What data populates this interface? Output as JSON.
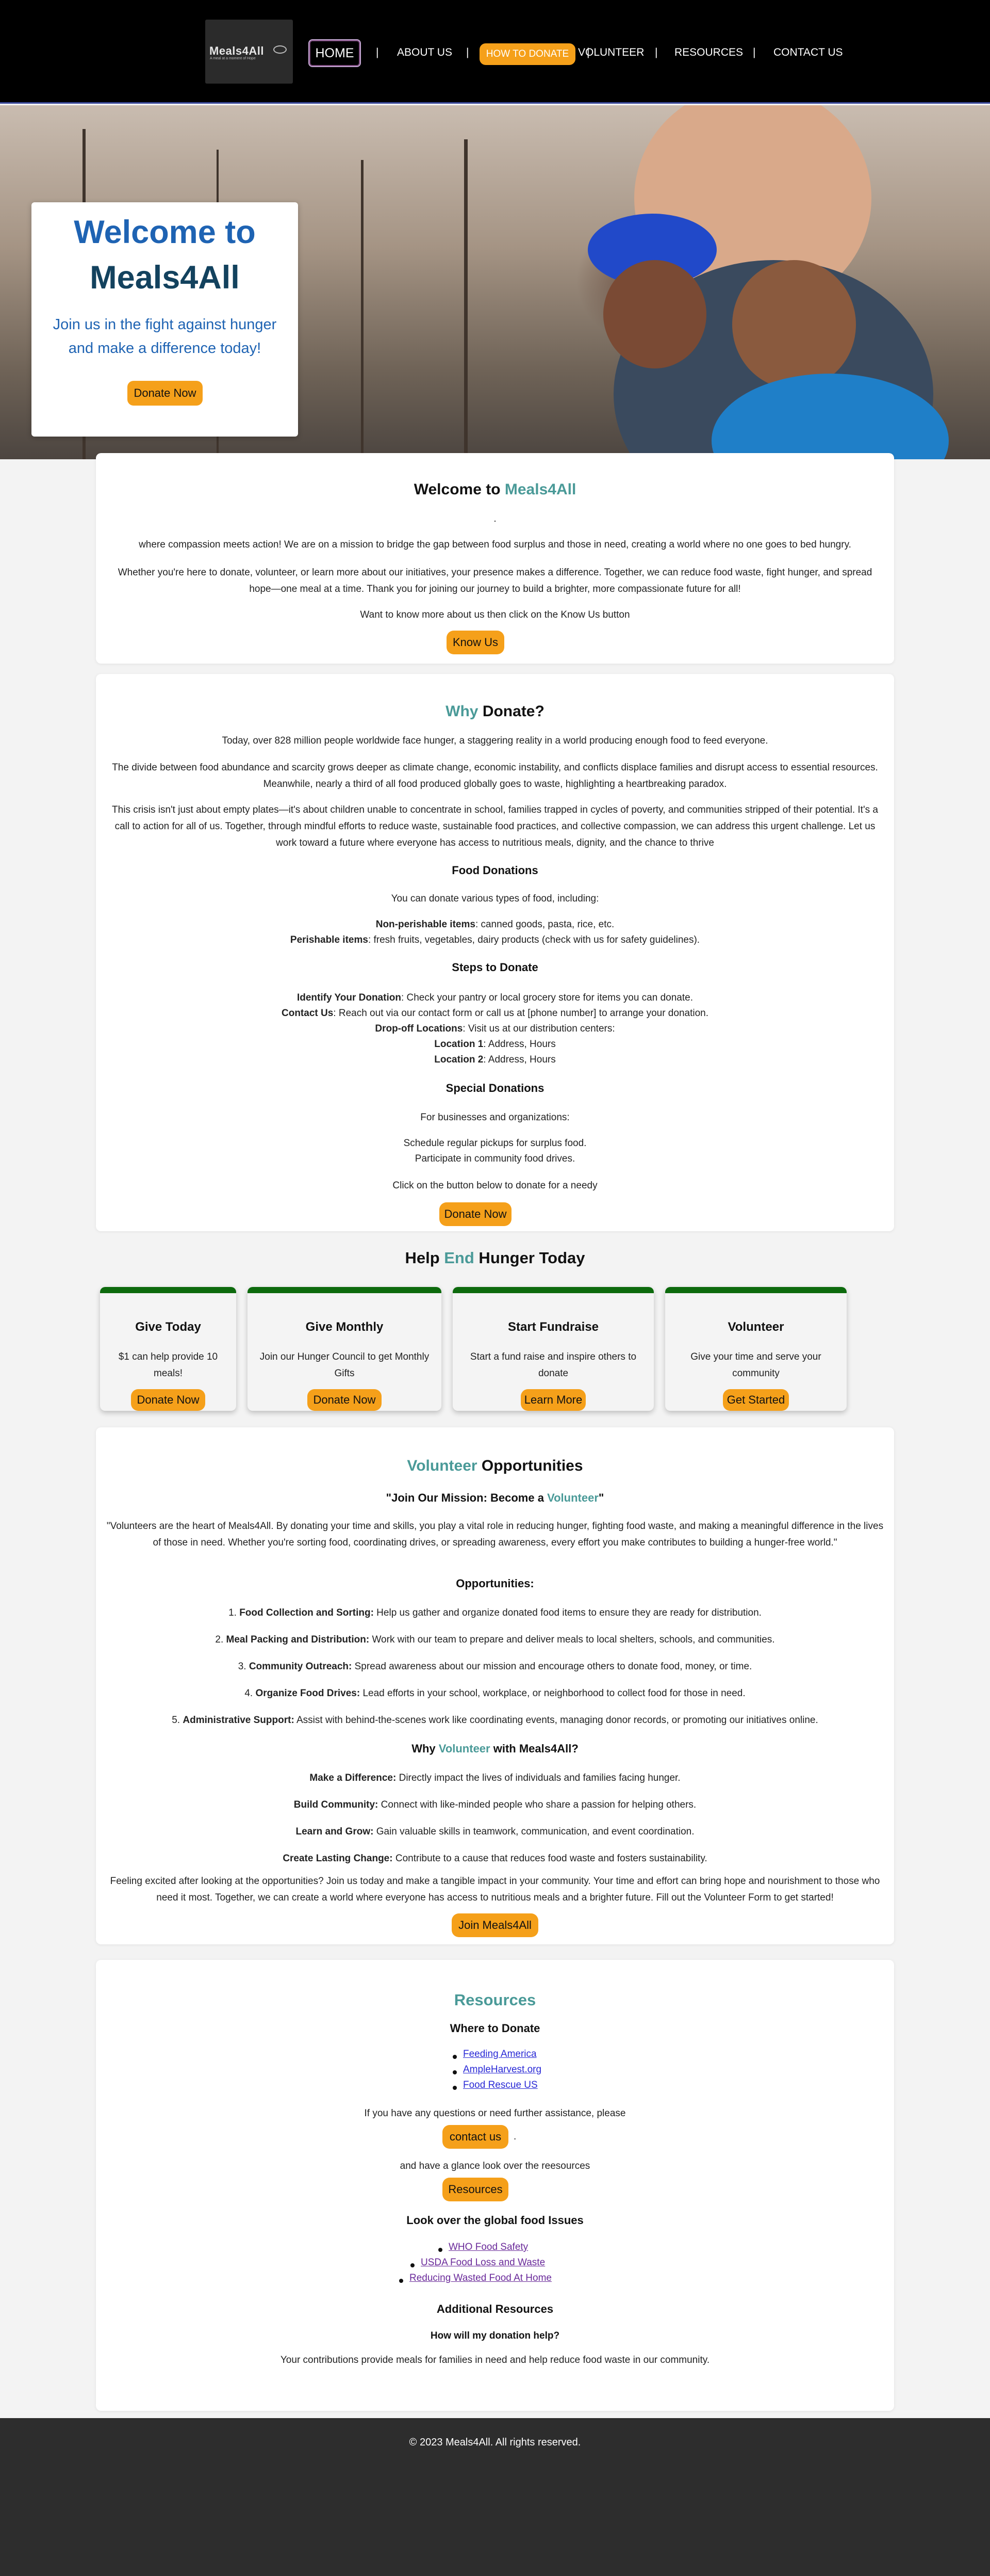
{
  "nav": {
    "logo_text": "Meals4All",
    "logo_tagline": "A meal at a moment of Hope",
    "home": "HOME",
    "about": "ABOUT US",
    "donate": "HOW TO DONATE",
    "volunteer": "VOLUNTEER",
    "resources": "RESOURCES",
    "contact": "CONTACT US",
    "separator": "|"
  },
  "hero": {
    "title_line1": "Welcome to",
    "title_line2": "Meals4All",
    "subtitle": "Join us in the fight against hunger and make a difference today!",
    "button": "Donate Now"
  },
  "welcome": {
    "title_prefix": "Welcome to ",
    "title_brand": "Meals4All",
    "dot": ".",
    "p1": "where compassion meets action! We are on a mission to bridge the gap between food surplus and those in need, creating a world where no one goes to bed hungry.",
    "p2": "Whether you're here to donate, volunteer, or learn more about our initiatives, your presence makes a difference. Together, we can reduce food waste, fight hunger, and spread hope—one meal at a time. Thank you for joining our journey to build a brighter, more compassionate future for all!",
    "p3": "Want to know more about us then click on the Know Us button",
    "button": "Know Us"
  },
  "why_donate": {
    "title_accent": "Why",
    "title_rest": " Donate?",
    "p1": "Today, over 828 million people worldwide face hunger, a staggering reality in a world producing enough food to feed everyone.",
    "p2": "The divide between food abundance and scarcity grows deeper as climate change, economic instability, and conflicts displace families and disrupt access to essential resources. Meanwhile, nearly a third of all food produced globally goes to waste, highlighting a heartbreaking paradox.",
    "p3": "This crisis isn't just about empty plates—it's about children unable to concentrate in school, families trapped in cycles of poverty, and communities stripped of their potential. It's a call to action for all of us. Together, through mindful efforts to reduce waste, sustainable food practices, and collective compassion, we can address this urgent challenge. Let us work toward a future where everyone has access to nutritious meals, dignity, and the chance to thrive",
    "food_heading": "Food Donations",
    "food_intro": "You can donate various types of food, including:",
    "nonperish_label": "Non-perishable items",
    "nonperish_text": ": canned goods, pasta, rice, etc.",
    "perish_label": "Perishable items",
    "perish_text": ": fresh fruits, vegetables, dairy products (check with us for safety guidelines).",
    "steps_heading": "Steps to Donate",
    "step1_label": "Identify Your Donation",
    "step1_text": ": Check your pantry or local grocery store for items you can donate.",
    "step2_label": "Contact Us",
    "step2_text": ": Reach out via our contact form or call us at [phone number] to arrange your donation.",
    "step3_label": "Drop-off Locations",
    "step3_text": ": Visit us at our distribution centers:",
    "loc1_label": "Location 1",
    "loc1_text": ": Address, Hours",
    "loc2_label": "Location 2",
    "loc2_text": ": Address, Hours",
    "special_heading": "Special Donations",
    "special_intro": "For businesses and organizations:",
    "special1": "Schedule regular pickups for surplus food.",
    "special2": "Participate in community food drives.",
    "cta": "Click on the button below to donate for a needy",
    "button": "Donate Now"
  },
  "help": {
    "title_prefix": "Help ",
    "title_accent": "End",
    "title_suffix": " Hunger Today",
    "cards": [
      {
        "title": "Give Today",
        "text": "$1 can help provide 10 meals!",
        "button": "Donate Now"
      },
      {
        "title": "Give Monthly",
        "text": "Join our Hunger Council to get Monthly Gifts",
        "button": "Donate Now"
      },
      {
        "title": "Start Fundraise",
        "text": "Start a fund raise and inspire others to donate",
        "button": "Learn More"
      },
      {
        "title": "Volunteer",
        "text": "Give your time and serve your community",
        "button": "Get Started"
      }
    ]
  },
  "volunteer": {
    "title_accent": "Volunteer",
    "title_rest": " Opportunities",
    "mission_prefix": "\"Join Our Mission: Become a ",
    "mission_accent": "Volunteer",
    "mission_suffix": "\"",
    "quote": "\"Volunteers are the heart of Meals4All. By donating your time and skills, you play a vital role in reducing hunger, fighting food waste, and making a meaningful difference in the lives of those in need. Whether you're sorting food, coordinating drives, or spreading awareness, every effort you make contributes to building a hunger-free world.\"",
    "opps_heading": "Opportunities:",
    "opps": [
      {
        "num": "1.",
        "label": "Food Collection and Sorting:",
        "text": " Help us gather and organize donated food items to ensure they are ready for distribution."
      },
      {
        "num": "2.",
        "label": "Meal Packing and Distribution:",
        "text": " Work with our team to prepare and deliver meals to local shelters, schools, and communities."
      },
      {
        "num": "3.",
        "label": "Community Outreach:",
        "text": " Spread awareness about our mission and encourage others to donate food, money, or time."
      },
      {
        "num": "4.",
        "label": "Organize Food Drives:",
        "text": " Lead efforts in your school, workplace, or neighborhood to collect food for those in need."
      },
      {
        "num": "5.",
        "label": "Administrative Support:",
        "text": " Assist with behind-the-scenes work like coordinating events, managing donor records, or promoting our initiatives online."
      }
    ],
    "why_prefix": "Why ",
    "why_accent": "Volunteer",
    "why_suffix": " with Meals4All?",
    "benefits": [
      {
        "label": "Make a Difference:",
        "text": " Directly impact the lives of individuals and families facing hunger."
      },
      {
        "label": "Build Community:",
        "text": " Connect with like-minded people who share a passion for helping others."
      },
      {
        "label": "Learn and Grow:",
        "text": " Gain valuable skills in teamwork, communication, and event coordination."
      },
      {
        "label": "Create Lasting Change:",
        "text": " Contribute to a cause that reduces food waste and fosters sustainability."
      }
    ],
    "closing": "Feeling excited after looking at the opportunities? Join us today and make a tangible impact in your community. Your time and effort can bring hope and nourishment to those who need it most. Together, we can create a world where everyone has access to nutritious meals and a brighter future. Fill out the Volunteer Form to get started!",
    "button": "Join Meals4All"
  },
  "resources": {
    "title": "Resources",
    "where_heading": "Where to Donate",
    "where_links": [
      "Feeding America",
      "AmpleHarvest.org",
      "Food Rescue US"
    ],
    "questions": "If you have any questions or need further assistance, please",
    "contact_button": "contact us",
    "period": ".",
    "glance": "and have a glance look over the reesources",
    "resources_button": "Resources",
    "global_heading": "Look over the global food Issues",
    "global_links": [
      "WHO Food Safety",
      "USDA Food Loss and Waste",
      "Reducing Wasted Food At Home"
    ],
    "additional_heading": "Additional Resources",
    "faq_q": "How will my donation help?",
    "faq_a": "Your contributions provide meals for families in need and help reduce food waste in our community."
  },
  "footer": {
    "text": "© 2023 Meals4All. All rights reserved."
  },
  "colors": {
    "accent_orange": "#f5a01a",
    "accent_teal": "#4a9a98",
    "hero_blue": "#1e63b3",
    "card_green": "#0d6a0d"
  }
}
